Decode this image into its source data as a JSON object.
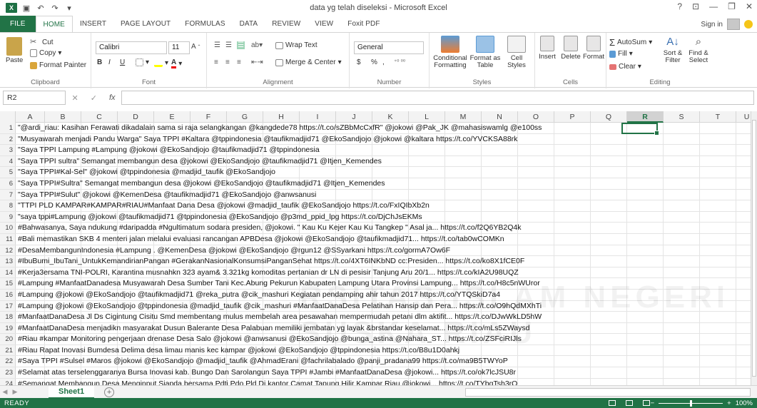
{
  "window": {
    "title": "data yg telah diseleksi - Microsoft Excel",
    "controls": [
      "?",
      "⊡",
      "—",
      "❐",
      "✕"
    ]
  },
  "ribbon_tabs": [
    "FILE",
    "HOME",
    "INSERT",
    "PAGE LAYOUT",
    "FORMULAS",
    "DATA",
    "REVIEW",
    "VIEW",
    "Foxit PDF"
  ],
  "active_tab": "HOME",
  "account": {
    "signin": "Sign in"
  },
  "clipboard": {
    "paste": "Paste",
    "cut": "Cut",
    "copy": "Copy",
    "format_painter": "Format Painter",
    "label": "Clipboard"
  },
  "font": {
    "name": "Calibri",
    "size": "11",
    "label": "Font",
    "bold": "B",
    "italic": "I",
    "underline": "U"
  },
  "alignment": {
    "wrap": "Wrap Text",
    "merge": "Merge & Center",
    "label": "Alignment"
  },
  "number": {
    "format": "General",
    "currency": "$",
    "percent": "%",
    "comma": ",",
    "label": "Number"
  },
  "styles": {
    "conditional": "Conditional Formatting",
    "format_table": "Format as Table",
    "cell_styles": "Cell Styles",
    "label": "Styles"
  },
  "cells": {
    "insert": "Insert",
    "delete": "Delete",
    "format": "Format",
    "label": "Cells"
  },
  "editing": {
    "autosum": "AutoSum",
    "fill": "Fill",
    "clear": "Clear",
    "sort": "Sort & Filter",
    "find": "Find & Select",
    "label": "Editing"
  },
  "formula_bar": {
    "name_box": "R2",
    "fx": "fx",
    "value": ""
  },
  "columns": [
    "A",
    "B",
    "C",
    "D",
    "E",
    "F",
    "G",
    "H",
    "I",
    "J",
    "K",
    "L",
    "M",
    "N",
    "O",
    "P",
    "Q",
    "R",
    "S",
    "T",
    "U"
  ],
  "selected_column": "R",
  "rows": [
    {
      "n": "1",
      "text": "\"@ardi_riau: Kasihan Ferawati dikadalain sama si raja selangkangan @kangdede78 https://t.co/sZBbMcCxfR\" @jokowi @Pak_JK @mahasiswamlg @e100ss"
    },
    {
      "n": "2",
      "text": "\"Musyawarah menjadi Pandu Warga\" Saya TPPI #Kaltara @tppindonesia @taufikmadjid71 @EkoSandjojo @jokowi @kaltara https://t.co/YVCKSA88rk"
    },
    {
      "n": "3",
      "text": "\"Saya TPPI Lampung #Lampung @jokowi @EkoSandjojo @taufikmadjid71 @tppindonesia"
    },
    {
      "n": "4",
      "text": "\"Saya TPPI sultra\" Semangat membangun desa @jokowi @EkoSandjojo @taufikmadjid71 @Itjen_Kemendes"
    },
    {
      "n": "5",
      "text": "\"Saya TPPI#Kal-Sel\" @jokowi @tppindonesia @madjid_taufik @EkoSandjojo"
    },
    {
      "n": "6",
      "text": "\"Saya TPPI#Sultra\" Semangat membangun desa @jokowi @EkoSandjojo @taufikmadjid71 @Itjen_Kemendes"
    },
    {
      "n": "7",
      "text": "\"Saya TPPI#Sulut\" @jokowi @KemenDesa @taufikmadjid71 @EkoSandjojo @anwsanusi"
    },
    {
      "n": "8",
      "text": "\"TTPI PLD KAMPAR#KAMPAR#RIAU#Manfaat Dana Desa @jokowi @madjid_taufik @EkoSandjojo https://t.co/FxIQIbXb2n"
    },
    {
      "n": "9",
      "text": "\"saya tppi#Lampung @jokowi @taufikmadjid71 @tppindonesia @EkoSandjojo @p3md_ppid_lpg https://t.co/DjChJsEKMs"
    },
    {
      "n": "10",
      "text": "#Bahwasanya, Saya ndukung #daripadda #Ngultimatum sodara presiden, @jokowi. \" Kau Ku Kejer Kau Ku Tangkep \" Asal ja... https://t.co/f2Q6YB2Q4k"
    },
    {
      "n": "11",
      "text": "#Bali memastikan SKB 4 menteri jalan melalui evaluasi rancangan APBDesa @jokowi @EkoSandjojo @taufikmadjid71... https://t.co/tab0wCOMKn"
    },
    {
      "n": "12",
      "text": "#DesaMembangunIndonesia #Lampung . @KemenDesa @jokowi @EkoSandjojo @rgun12 @SSyarkani https://t.co/gormA7Ow6F"
    },
    {
      "n": "13",
      "text": "#IbuBumi_IbuTani_UntukKemandirianPangan #GerakanNasionalKonsumsiPanganSehat https://t.co/4XT6INKbND cc:Presiden... https://t.co/ko8X1fCE0F"
    },
    {
      "n": "14",
      "text": "#Kerja3ersama TNI-POLRI, Karantina musnahkn 323 ayam& 3.321kg komoditas pertanian dr LN di pesisir Tanjung Aru 20/1... https://t.co/kIA2U98UQZ"
    },
    {
      "n": "15",
      "text": "#Lampung #ManfaatDanadesa Musyawarah Desa Sumber Tani Kec.Abung Pekurun Kabupaten Lampung Utara Provinsi Lampung... https://t.co/H8c5nWUror"
    },
    {
      "n": "16",
      "text": "#Lampung @jokowi @EkoSandjojo @taufikmadjid71 @reka_putra @cik_mashuri Kegiatan pendamping ahir tahun 2017 https://t.co/YTQSkiD7a4"
    },
    {
      "n": "17",
      "text": "#Lampung @jokowi @EkoSandjojo @tppindonesia @madjid_taufik @cik_mashuri #ManfaatDanaDesa Pelatihan Hansip dan Pera... https://t.co/O9hQdMXhTi"
    },
    {
      "n": "18",
      "text": "#ManfaatDanaDesa Jl Ds Cigintung Cisitu Smd membentang mulus membelah area pesawahan mempermudah petani dlm aktifit... https://t.co/DJwWkLD5hW"
    },
    {
      "n": "19",
      "text": "#ManfaatDanaDesa menjadikn masyarakat Dusun Balerante Desa Palabuan memiliki jembatan yg layak &brstandar keselamat... https://t.co/mLs5ZWaysd"
    },
    {
      "n": "20",
      "text": "#Riau #kampar Monitoring pengerjaan drenase Desa Salo @jokowi @anwsanusi @EkoSandjojo @bunga_astina @Nahara_ST... https://t.co/ZSFciRIJls"
    },
    {
      "n": "21",
      "text": "#Riau Rapat Inovasi Bumdesa Delima desa limau manis kec kampar @jokowi @EkoSandjojo @tppindonesia https://t.co/B8u1D0ahkj"
    },
    {
      "n": "22",
      "text": "#Saya TPPI #Sulsel #Maros @jokowi @EkoSandjojo @madjid_taufik @AhmadErani @fachrilabalado @panji_pradana99 https://t.co/ma9B5TWYoP"
    },
    {
      "n": "23",
      "text": "#Selamat atas terselenggaranya Bursa Inovasi kab. Bungo Dan Sarolangun Saya TPPI #Jambi #ManfaatDanaDesa @jokowi... https://t.co/ok7lcJSU8r"
    },
    {
      "n": "24",
      "text": "#Semangat Membangun Desa Menginput Siapda bersama Pdti Pdo Pld Di kantor Camat Tapung Hilir Kampar Riau @jokowi... https://t.co/TYbgTsh3rQ"
    }
  ],
  "sheets": [
    "Sheet1"
  ],
  "status": {
    "ready": "READY",
    "zoom": "100%"
  },
  "watermark": "RSITAS ISLAM NEGERI SUSKA RIAU"
}
